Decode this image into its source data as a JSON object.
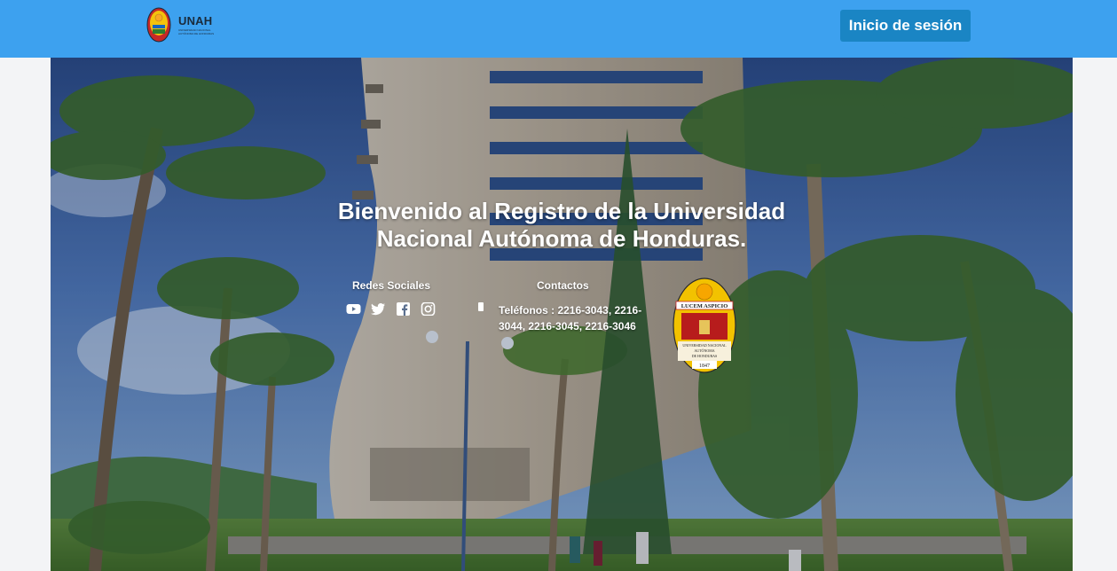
{
  "header": {
    "logo_icon": "unah-crest-icon",
    "brand_name": "UNAH",
    "brand_subtitle": "UNIVERSIDAD NACIONAL AUTÓNOMA DE HONDURAS",
    "login_label": "Inicio de sesión",
    "background_color": "#3da1ef",
    "button_color": "#1a85c4"
  },
  "hero": {
    "title_line1": "Bienvenido al Registro de la Universidad",
    "title_line2": "Nacional Autónoma de Honduras.",
    "social": {
      "heading": "Redes Sociales",
      "icons": [
        "youtube-icon",
        "twitter-icon",
        "facebook-icon",
        "instagram-icon"
      ]
    },
    "contacts": {
      "heading": "Contactos",
      "phone_icon": "phone-icon",
      "phones": "Teléfonos : 2216-3043, 2216-3044, 2216-3045, 2216-3046"
    },
    "seal": {
      "motto": "LUCEM ASPICIO",
      "line1": "UNIVERSIDAD NACIONAL",
      "line2": "AUTÓNOMA",
      "line3": "DE HONDURAS",
      "year": "1847"
    }
  }
}
